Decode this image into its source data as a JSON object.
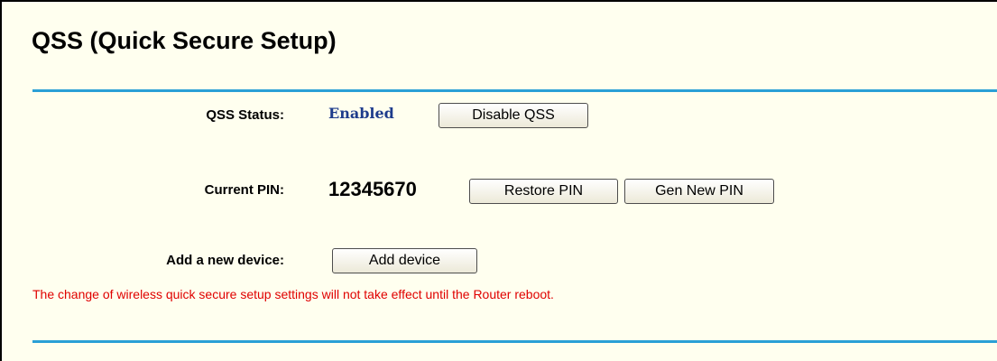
{
  "page": {
    "title": "QSS (Quick Secure Setup)"
  },
  "status": {
    "label": "QSS Status:",
    "value": "Enabled",
    "disable_button": "Disable QSS"
  },
  "pin": {
    "label": "Current PIN:",
    "value": "12345670",
    "restore_button": "Restore PIN",
    "gen_button": "Gen New PIN"
  },
  "device": {
    "label": "Add a new device:",
    "add_button": "Add device"
  },
  "notice": "The change of wireless quick secure setup settings will not take effect until the Router reboot.",
  "colors": {
    "background": "#ffffef",
    "rule": "#2ba0d6",
    "status_value": "#1e3c8c",
    "notice": "#e00000"
  }
}
